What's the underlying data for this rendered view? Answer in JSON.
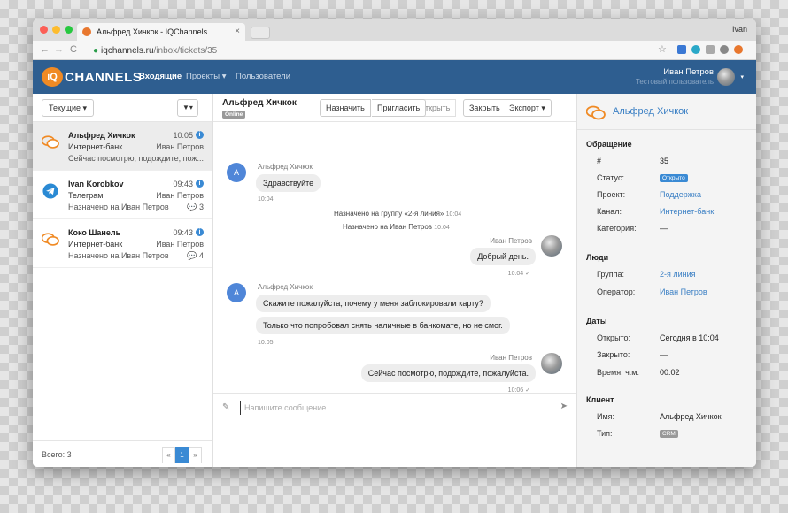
{
  "browser": {
    "tab_title": "Альфред Хичкок - IQChannels",
    "tab_close": "×",
    "user": "Ivan",
    "url_host": "iqchannels.ru",
    "url_path": "/inbox/tickets/35",
    "back": "←",
    "forward": "→",
    "reload": "C",
    "star": "☆"
  },
  "app": {
    "logo_badge": "iQ",
    "logo_text": "CHANNELS",
    "nav": [
      {
        "label": "Входящие"
      },
      {
        "label": "Проекты ▾"
      },
      {
        "label": "Пользователи"
      }
    ],
    "user_name": "Иван Петров",
    "user_subtitle": "Тестовый пользователь",
    "user_caret": "▾"
  },
  "left": {
    "filter_label": "Текущие ▾",
    "filter_icon_label": "▼▾",
    "conversations": [
      {
        "name": "Альфред Хичкок",
        "time": "10:05",
        "channel": "Интернет-банк",
        "agent": "Иван Петров",
        "preview": "Сейчас посмотрю, подождите, пож...",
        "count": ""
      },
      {
        "name": "Ivan Korobkov",
        "time": "09:43",
        "channel": "Телеграм",
        "agent": "Иван Петров",
        "preview": "Назначено на Иван Петров",
        "count": "💬 3"
      },
      {
        "name": "Коко Шанель",
        "time": "09:43",
        "channel": "Интернет-банк",
        "agent": "Иван Петров",
        "preview": "Назначено на Иван Петров",
        "count": "💬 4"
      }
    ],
    "info_glyph": "i",
    "total": "Всего: 3",
    "pager": {
      "prev": "«",
      "current": "1",
      "next": "»"
    }
  },
  "chat": {
    "title": "Альфред Хичкок",
    "status": "Online",
    "actions": {
      "assign": "Назначить",
      "invite": "Пригласить",
      "open": "Открыть",
      "close": "Закрыть",
      "export": "Экспорт ▾"
    },
    "messages": {
      "m1_avatar": "A",
      "m1_author": "Альфред Хичкок",
      "m1_text": "Здравствуйте",
      "m1_time": "10:04",
      "sys1_text": "Назначено на группу «2-я линия»",
      "sys1_time": "10:04",
      "sys2_text": "Назначено на Иван Петров",
      "sys2_time": "10:04",
      "m2_author": "Иван Петров",
      "m2_text": "Добрый день.",
      "m2_time": "10:04 ✓",
      "m3_avatar": "A",
      "m3_author": "Альфред Хичкок",
      "m3_text1": "Скажите пожалуйста, почему у меня заблокировали карту?",
      "m3_text2": "Только что попробовал снять наличные в банкомате, но не смог.",
      "m3_time": "10:05",
      "m4_author": "Иван Петров",
      "m4_text": "Сейчас посмотрю, подождите, пожалуйста.",
      "m4_time": "10:06 ✓"
    },
    "composer_placeholder": "Напишите сообщение...",
    "clip_glyph": "✎",
    "send_glyph": "➤"
  },
  "details": {
    "client_name": "Альфред Хичкок",
    "sections": {
      "ticket": "Обращение",
      "people": "Люди",
      "dates": "Даты",
      "client": "Клиент"
    },
    "ticket": {
      "id_label": "#",
      "id_value": "35",
      "status_label": "Статус:",
      "status_value": "Открыто",
      "project_label": "Проект:",
      "project_value": "Поддержка",
      "channel_label": "Канал:",
      "channel_value": "Интернет-банк",
      "category_label": "Категория:",
      "category_value": "—"
    },
    "people": {
      "group_label": "Группа:",
      "group_value": "2-я линия",
      "operator_label": "Оператор:",
      "operator_value": "Иван Петров"
    },
    "dates": {
      "opened_label": "Открыто:",
      "opened_value": "Сегодня в 10:04",
      "closed_label": "Закрыто:",
      "closed_value": "—",
      "time_label": "Время, ч:м:",
      "time_value": "00:02"
    },
    "client": {
      "name_label": "Имя:",
      "name_value": "Альфред Хичкок",
      "type_label": "Тип:",
      "type_value": "CRM"
    }
  },
  "colors": {
    "header": "#2e5e90",
    "accent": "#3a8ad4",
    "logo": "#f08a24"
  }
}
